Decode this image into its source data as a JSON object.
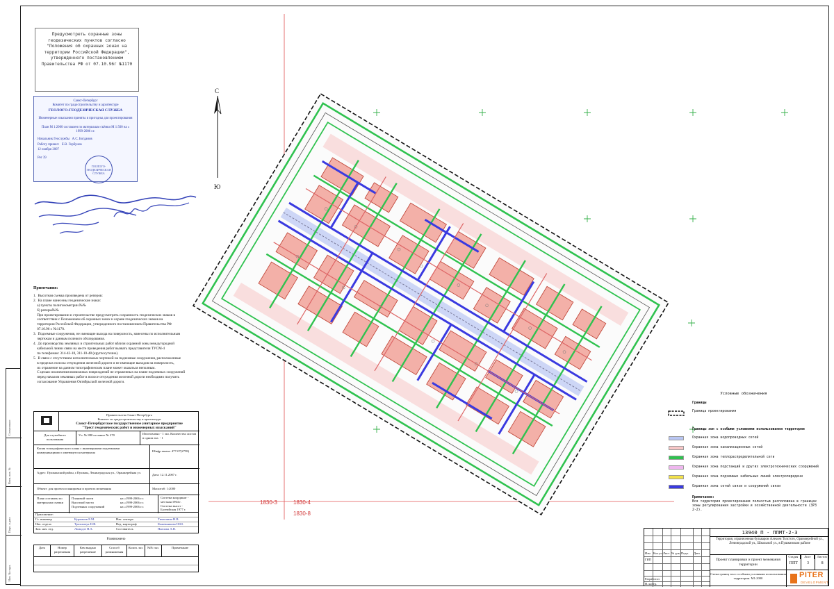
{
  "stamp_top_note": "Предусмотреть охранные зоны геодезических пунктов согласно \"Положения об охранных зонах на территории Российской Федерации\", утвержденного постановлением Правительства РФ от 07.10.96г №1170",
  "stamp_ggs": {
    "l1": "Санкт-Петербург",
    "l2": "Комитет по градостроительству и архитектуре",
    "l3": "ГЕОЛОГО-ГЕОДЕЗИЧЕСКАЯ СЛУЖБА",
    "l4": "Инженерные изыскания приняты в пригодны для проектирования",
    "l5": "План М 1:2000 составлен по материалам съёмки М 1:500 на « 1999-2006 г.г.",
    "head_label": "Начальник Геослужбы",
    "head_name": "А.С. Богданов",
    "work_label": "Работу принял:",
    "work_name": "Е.В. Горбунов",
    "date": "12   ноября   2007",
    "reg": "Рег 39",
    "seal_text": "ГЕОЛОГО-ГЕОДЕЗИЧЕСКАЯ СЛУЖБА"
  },
  "notes": {
    "title": "Примечания:",
    "lines": [
      "1.  Высотная съемка произведена от реперов:",
      "2.  На плане нанесены геодезические знаки:",
      "    а) пункты полигонометрии №№",
      "    б) реперы№№",
      "    При проектировании и строительстве предусмотреть сохранность геодезических знаков в",
      "    соответствии с Положением об охранных зонах и охране геодезических знаков на",
      "    территории Российской Федерации, утвержденного постановлением Правительства РФ",
      "    07.10.96 г. №1170.",
      "3.  Подземные сооружения, не имеющие выхода на поверхность, нанесены по исполнительным",
      "    чертежам и данным полевого обследования.",
      "4.  До производства земляных и строительных работ вблизи охранной зоны междугородной",
      "    кабельной линии связи на месте проведения работ вызвать представителя ТУСМ-4",
      "    по телефонам: 314-42-18, 311-10-48 (круглосуточно).",
      "5.  В связи с отсутствием исполнительных чертежей на подземные сооружения, расположенные",
      "    в пределах полосы отчуждения железной дороги и не имеющие выходов на поверхность,",
      "    их отражение на данном топографическом плане может оказаться неполным.",
      "    С целью исключения возможных повреждений не отраженных на плане подземных сооружений",
      "    перед началом земляных работ в полосе отчуждения железной дороги необходимо получить",
      "    согласование Управления Октябрьской железной дороги."
    ]
  },
  "titleblock": {
    "org1": "Правительство Санкт-Петербурга",
    "org2": "Комитет по градостроительству и архитектуре",
    "org3": "Санкт-Петербургское государственное унитарное предприятие",
    "org4": "\"Трест геодезических работ и инженерных изысканий\"",
    "usage": "Для служебного пользования",
    "uch": "Уч. № 880 по книге № 270",
    "copies": "Изготовлено - 1 экз. Количество листов в одном экз. - 1",
    "copy_title": "Копия топографического плана с инженерными подземными коммуникациями с имеющегося материала",
    "cipher": "Шифр заказа: 477-07(2758)",
    "address": "Адрес: Пушкинский район, г.Пушкин, Ленинградская ул., Оранжерейная ул.",
    "date": "Дата: 12.11.2007 г.",
    "scale": "Масштаб: 1:2000",
    "object": "Объект: для проекта планировки и проекта межевания",
    "source_label": "План составлен по материалам съемки",
    "plan_part": "Плановой части",
    "height_part": "Высотной части",
    "underground": "Подземных сооружений",
    "plan_years": "на «1999-2006 г.г.",
    "height_years": "на «1999-2006 г.г.",
    "under_years": "на «1999-2006 г.г.",
    "coord_sys": "Система координат - местная 1964 г.",
    "height_sys": "Система высот - Балтийская 1977 г."
  },
  "approvals": {
    "title": "Приложение:",
    "rows": [
      [
        "Гл. инженер",
        "Курманов Б.М.",
        "Нач. сектора",
        "Тимошина Н.В."
      ],
      [
        "Нач. отдела",
        "Трохимчук Н.В.",
        "Вед. картограф",
        "Кожевникова Н.Ю."
      ],
      [
        "Зам. нач. отд.",
        "Ломидзе Н.А.",
        "Составитель",
        "Павлова А.В."
      ]
    ]
  },
  "agreement": {
    "title": "Размножено",
    "headers": [
      "Дата",
      "Номер разрешения",
      "Кем выдано разрешение",
      "Способ размножения",
      "Колич. экз.",
      "№№ экз.",
      "Примечание"
    ]
  },
  "sidestrip": [
    "Согласовано",
    "Взам. инв. №",
    "Подп. и дата",
    "Инв. № подл."
  ],
  "map": {
    "north": "С",
    "south": "Ю",
    "coord_left": "1830-3",
    "coord_right": "1830-4",
    "coord_bottom": "1830-8",
    "colors": {
      "water": "#7a98e6",
      "sewer": "#f3a3a3",
      "heat": "#2fc24f",
      "power": "#e89ae8",
      "cable": "#f2e14a",
      "telecom": "#3a3ae0",
      "boundary": "#111111"
    }
  },
  "legend": {
    "title": "Условные обозначения",
    "boundary_head": "Границы",
    "boundary_design": "Граница проектирования",
    "zones_head": "Границы зон с особыми условиями использования территории",
    "items": [
      {
        "label": "Охранная зона водопроводных сетей",
        "color": "#b9c6f3"
      },
      {
        "label": "Охранная зона канализационных сетей",
        "color": "#f7c6c6"
      },
      {
        "label": "Охранная зона теплораспределительной сети",
        "color": "#2fc24f"
      },
      {
        "label": "Охранная зона подстанций и других электротехнических сооружений",
        "color": "#efb6ef"
      },
      {
        "label": "Охранная зона подземных кабельных линий электропередачи",
        "color": "#f2e14a"
      },
      {
        "label": "Охранная зона сетей связи и сооружений связи",
        "color": "#3a3ae0"
      }
    ],
    "note_head": "Примечание:",
    "note": "Вся территория проектирования полностью расположена в границах зоны регулирования застройки и хозяйственной деятельности (ЗРЗ 2-2)."
  },
  "main_stamp": {
    "code": "13940_П - ППМТ-2-3",
    "address": "Территория, ограниченная бульваром Алексея Толстого, Оранжерейной ул., Ленинградской ул., Школьной ул., в Пушкинском районе",
    "col_headers": [
      "Изм",
      "Кол.уч",
      "Лист",
      "№ док.",
      "Подп.",
      "Дата"
    ],
    "gip": "ГИП",
    "developer": "Разработал",
    "control": "Н. контр.",
    "project": "Проект планировки и проект межевания территории",
    "stage_label": "Стадия",
    "sheet_label": "Лист",
    "sheets_label": "Листов",
    "stage": "ППТ",
    "sheet": "3",
    "sheets": "8",
    "sheet_name": "Схема границ зон с особыми условиями использования территории. М1:2000",
    "logo_main": "PITER",
    "logo_sub": "DEVELOPMENT"
  }
}
